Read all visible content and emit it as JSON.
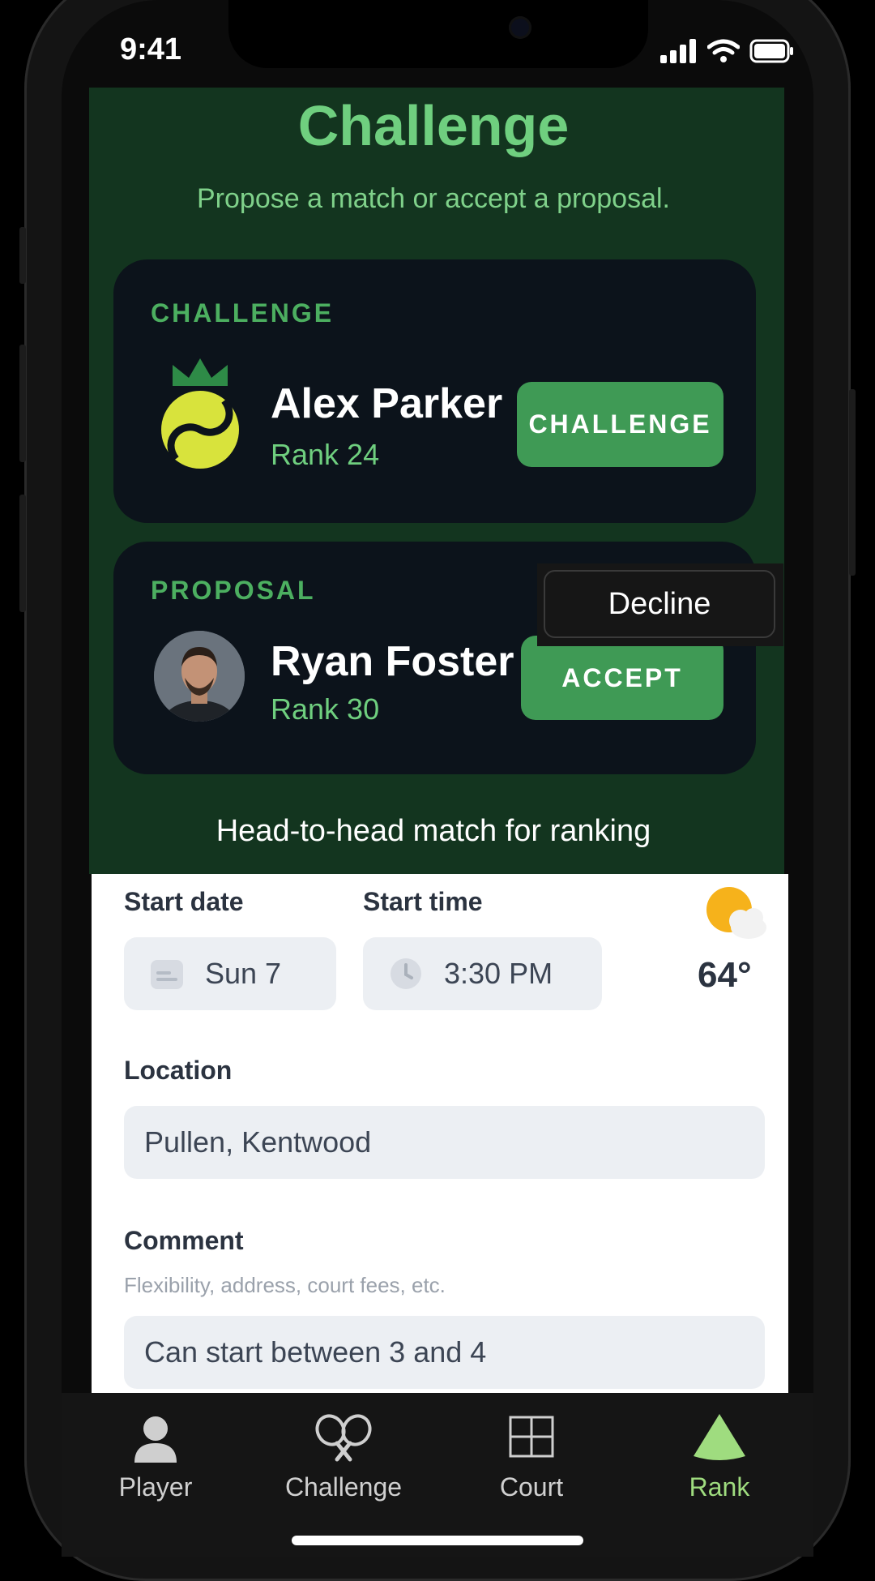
{
  "status": {
    "time": "9:41"
  },
  "header": {
    "title": "Challenge",
    "subtitle": "Propose a match or accept a proposal."
  },
  "challenge_card": {
    "label": "CHALLENGE",
    "name": "Alex Parker",
    "rank": "Rank 24",
    "button": "CHALLENGE",
    "avatar_icon": "tennis-ball-crown-icon"
  },
  "proposal_card": {
    "label": "PROPOSAL",
    "name": "Ryan Foster",
    "rank": "Rank 30",
    "accept_button": "ACCEPT",
    "decline_button": "Decline"
  },
  "match_type": "Head-to-head match for ranking",
  "form": {
    "start_date_label": "Start date",
    "start_date_value": "Sun 7",
    "start_time_label": "Start time",
    "start_time_value": "3:30 PM",
    "temperature": "64°",
    "location_label": "Location",
    "location_value": "Pullen, Kentwood",
    "comment_label": "Comment",
    "comment_hint": "Flexibility, address, court fees, etc.",
    "comment_value": "Can start between 3 and 4"
  },
  "tabs": [
    {
      "label": "Player",
      "icon": "person-icon",
      "active": false
    },
    {
      "label": "Challenge",
      "icon": "rackets-icon",
      "active": false
    },
    {
      "label": "Court",
      "icon": "court-grid-icon",
      "active": false
    },
    {
      "label": "Rank",
      "icon": "triangle-icon",
      "active": true
    }
  ],
  "colors": {
    "background_green": "#13351f",
    "accent_green": "#6fcf7f",
    "button_green": "#3f9a55",
    "card_dark": "#0c131b"
  }
}
